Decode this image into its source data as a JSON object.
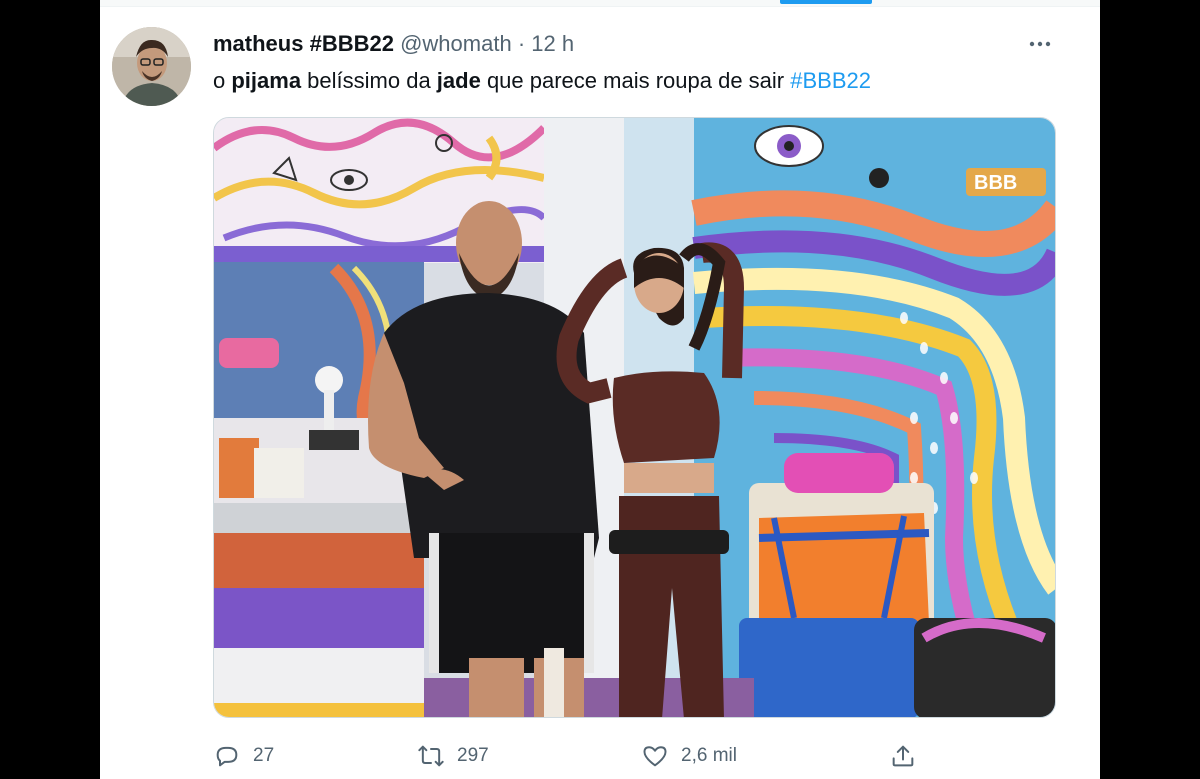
{
  "tweet": {
    "display_name": "matheus #BBB22",
    "handle": "@whomath",
    "separator": "·",
    "time": "12 h",
    "text_parts": {
      "p1": "o ",
      "p2": "pijama",
      "p3": " belíssimo da ",
      "p4": "jade",
      "p5": " que parece mais roupa de sair ",
      "hashtag": "#BBB22"
    },
    "media": {
      "logo_text": "BBB",
      "description_icon": "photo"
    },
    "stats": {
      "replies": "27",
      "retweets": "297",
      "likes": "2,6 mil"
    }
  },
  "icons": {
    "reply": "reply-icon",
    "retweet": "retweet-icon",
    "like": "heart-icon",
    "share": "share-icon",
    "more": "more-icon"
  },
  "colors": {
    "accent": "#1d9bf0",
    "text": "#0f1419",
    "secondary": "#536471"
  }
}
